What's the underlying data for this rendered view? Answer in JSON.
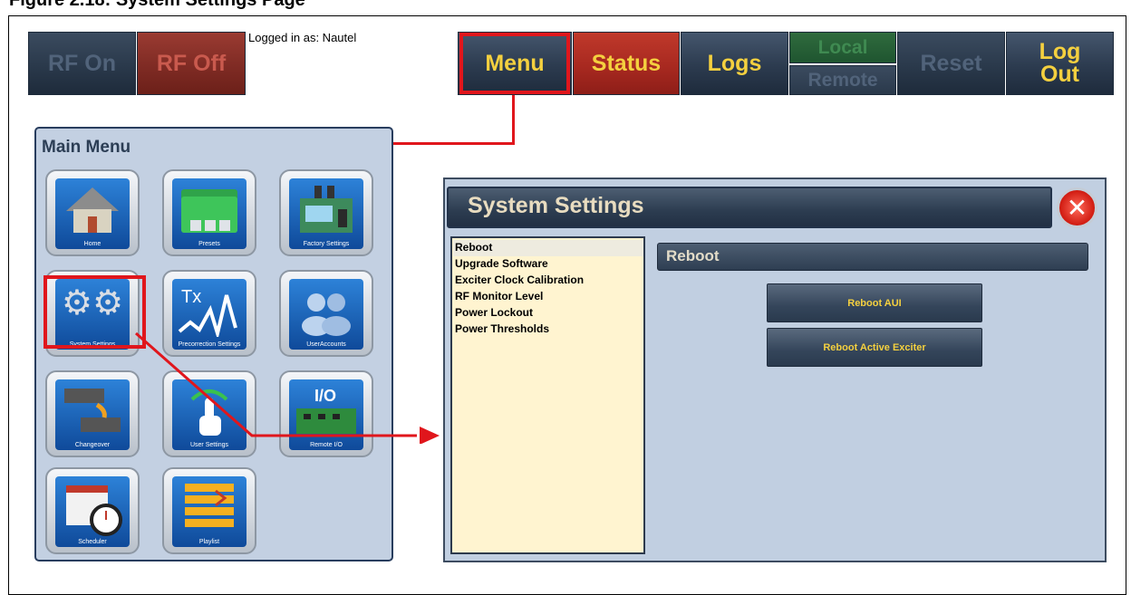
{
  "caption": "Figure 2.18: System Settings Page",
  "toolbar": {
    "rf_on": "RF On",
    "rf_off": "RF Off",
    "logged_in": "Logged in as: Nautel",
    "menu": "Menu",
    "status": "Status",
    "logs": "Logs",
    "local": "Local",
    "remote": "Remote",
    "reset": "Reset",
    "logout_line1": "Log",
    "logout_line2": "Out"
  },
  "main_menu": {
    "title": "Main Menu",
    "tiles": [
      {
        "label": "Home",
        "icon": "home-icon"
      },
      {
        "label": "Presets",
        "icon": "folder-icon"
      },
      {
        "label": "Factory Settings",
        "icon": "factory-icon"
      },
      {
        "label": "System Settings",
        "icon": "gears-icon"
      },
      {
        "label": "Precorrection Settings",
        "icon": "waveform-icon"
      },
      {
        "label": "UserAccounts",
        "icon": "users-icon"
      },
      {
        "label": "Changeover",
        "icon": "changeover-icon"
      },
      {
        "label": "User Settings",
        "icon": "touch-icon"
      },
      {
        "label": "Remote I/O",
        "icon": "circuit-board-icon"
      },
      {
        "label": "Scheduler",
        "icon": "calendar-clock-icon"
      },
      {
        "label": "Playlist",
        "icon": "playlist-icon"
      }
    ]
  },
  "system_settings": {
    "title": "System Settings",
    "list": [
      "Reboot",
      "Upgrade Software",
      "Exciter Clock Calibration",
      "RF Monitor Level",
      "Power Lockout",
      "Power Thresholds"
    ],
    "selected_index": 0,
    "section_title": "Reboot",
    "buttons": [
      "Reboot AUI",
      "Reboot Active Exciter"
    ]
  },
  "colors": {
    "highlight": "#e0161c",
    "button_text": "#f4d03f",
    "status_red": "#c0392b",
    "panel_bg": "#c3d0e2"
  }
}
